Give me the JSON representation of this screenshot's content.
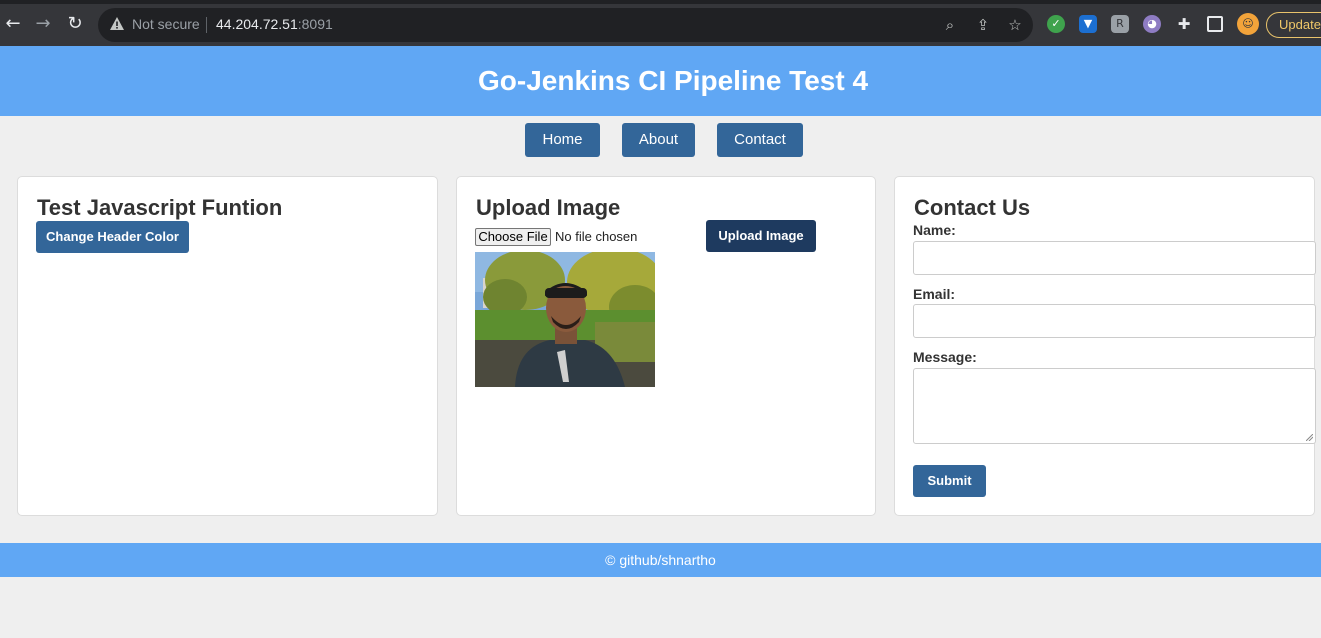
{
  "browser": {
    "security_label": "Not secure",
    "url_host": "44.204.72.51",
    "url_port": ":8091",
    "update_label": "Update"
  },
  "header": {
    "title": "Go-Jenkins CI Pipeline Test 4"
  },
  "nav": {
    "home": "Home",
    "about": "About",
    "contact": "Contact"
  },
  "js_card": {
    "title": "Test Javascript Funtion",
    "button": "Change Header Color"
  },
  "upload_card": {
    "title": "Upload Image",
    "choose_file": "Choose File",
    "no_file": "No file chosen",
    "button": "Upload Image"
  },
  "contact_card": {
    "title": "Contact Us",
    "name_label": "Name:",
    "email_label": "Email:",
    "message_label": "Message:",
    "submit": "Submit"
  },
  "footer": {
    "text": "© github/shnartho"
  },
  "colors": {
    "header_bg": "#60a7f4",
    "button_bg": "#336699",
    "upload_button_bg": "#1e3a5f"
  }
}
